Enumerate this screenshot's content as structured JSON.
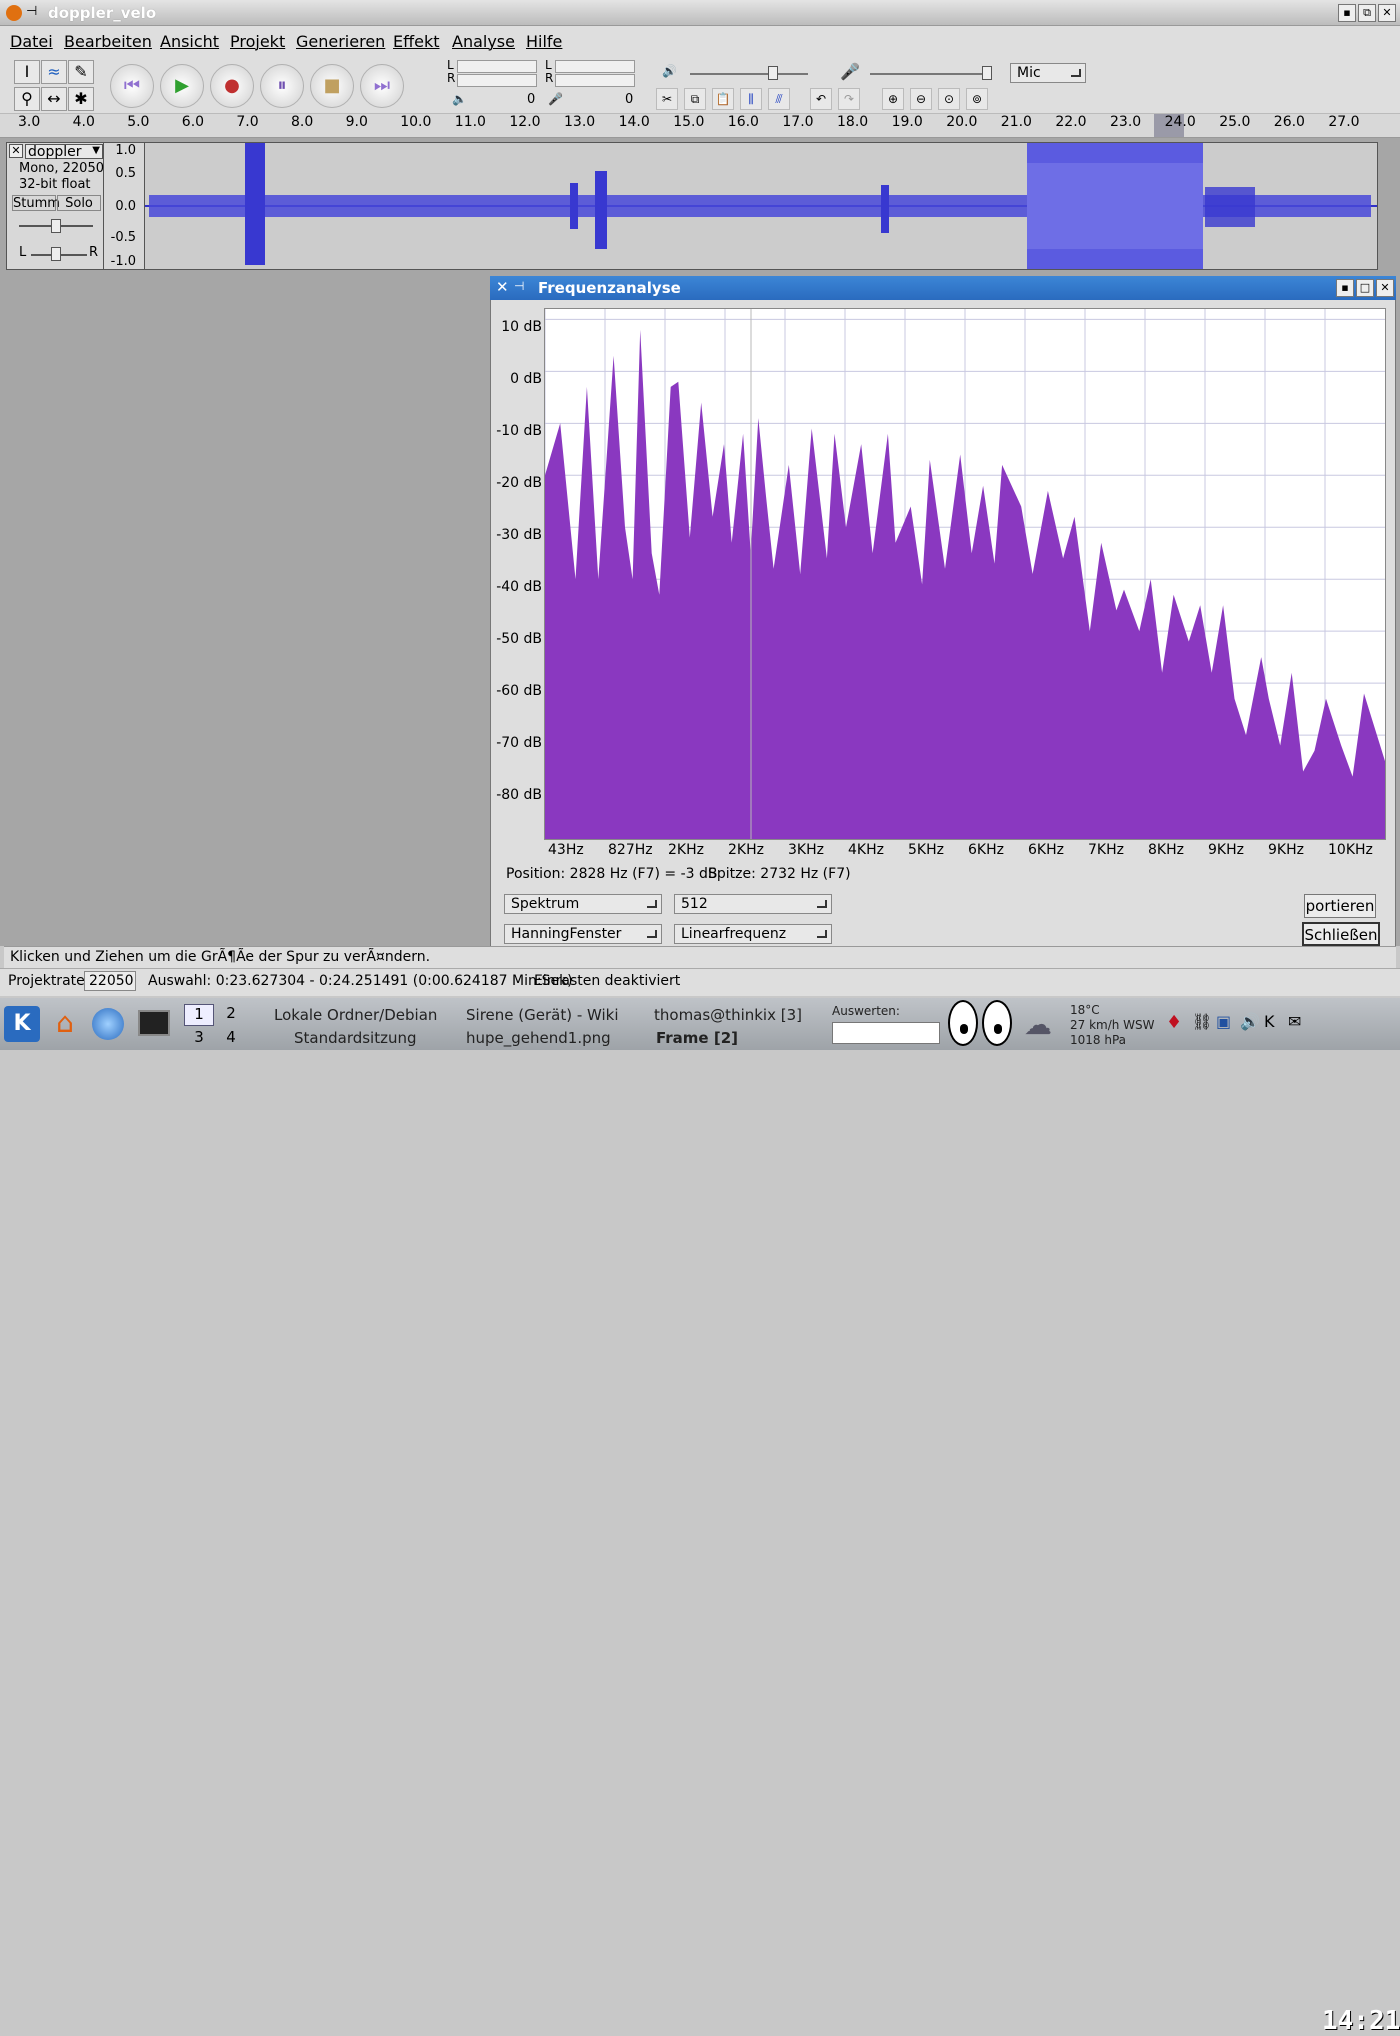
{
  "window": {
    "title": "doppler_velo"
  },
  "menu": [
    "Datei",
    "Bearbeiten",
    "Ansicht",
    "Projekt",
    "Generieren",
    "Effekt",
    "Analyse",
    "Hilfe"
  ],
  "toolbar": {
    "meter_l": "L",
    "meter_r": "R",
    "out_val": "0",
    "in_val": "0",
    "input_source": "Mic"
  },
  "ruler": [
    "3.0",
    "4.0",
    "5.0",
    "6.0",
    "7.0",
    "8.0",
    "9.0",
    "10.0",
    "11.0",
    "12.0",
    "13.0",
    "14.0",
    "15.0",
    "16.0",
    "17.0",
    "18.0",
    "19.0",
    "20.0",
    "21.0",
    "22.0",
    "23.0",
    "24.0",
    "25.0",
    "26.0",
    "27.0"
  ],
  "track": {
    "name": "doppler",
    "info1": "Mono, 22050 Hz",
    "info2": "32-bit float",
    "mute": "Stumm",
    "solo": "Solo",
    "left": "L",
    "right": "R",
    "scale": [
      "1.0",
      "0.5",
      "0.0",
      "-0.5",
      "-1.0"
    ]
  },
  "dialog": {
    "title": "Frequenzanalyse",
    "position": "Position: 2828 Hz (F7) = -3 dB",
    "peak": "Spitze: 2732 Hz (F7)",
    "algorithm": "Spektrum",
    "size": "512",
    "window_func": "HanningFenster",
    "axis_mode": "Linearfrequenz",
    "export": "portieren",
    "close": "Schließen"
  },
  "chart_data": {
    "type": "area",
    "title": "",
    "ylabel": "",
    "xlabel": "",
    "y_ticks": [
      "10 dB",
      "0 dB",
      "-10 dB",
      "-20 dB",
      "-30 dB",
      "-40 dB",
      "-50 dB",
      "-60 dB",
      "-70 dB",
      "-80 dB"
    ],
    "x_ticks": [
      "43Hz",
      "827Hz",
      "2KHz",
      "2KHz",
      "3KHz",
      "4KHz",
      "5KHz",
      "6KHz",
      "6KHz",
      "7KHz",
      "8KHz",
      "9KHz",
      "9KHz",
      "10KHz"
    ],
    "ylim": [
      -90,
      12
    ],
    "xlim": [
      0,
      11025
    ],
    "series": [
      {
        "color": "#8a38c0",
        "x": [
          0,
          200,
          400,
          550,
          700,
          900,
          1050,
          1150,
          1250,
          1400,
          1500,
          1650,
          1750,
          1900,
          2050,
          2200,
          2350,
          2450,
          2600,
          2700,
          2800,
          2900,
          3000,
          3200,
          3350,
          3500,
          3700,
          3800,
          3950,
          4150,
          4300,
          4500,
          4600,
          4800,
          4950,
          5050,
          5250,
          5450,
          5600,
          5750,
          5900,
          6000,
          6250,
          6400,
          6600,
          6800,
          6950,
          7150,
          7300,
          7500,
          7600,
          7800,
          7950,
          8100,
          8250,
          8450,
          8600,
          8750,
          8900,
          9050,
          9200,
          9400,
          9500,
          9650,
          9800,
          9950,
          10100,
          10250,
          10450,
          10600,
          10750,
          11025
        ],
        "values": [
          -20,
          -10,
          -40,
          -3,
          -40,
          3,
          -30,
          -40,
          8,
          -35,
          -43,
          -3,
          -2,
          -32,
          -6,
          -28,
          -14,
          -33,
          -12,
          -35,
          -9,
          -24,
          -38,
          -18,
          -39,
          -11,
          -36,
          -12,
          -30,
          -14,
          -35,
          -12,
          -33,
          -26,
          -41,
          -17,
          -38,
          -16,
          -35,
          -22,
          -37,
          -18,
          -26,
          -39,
          -23,
          -36,
          -28,
          -50,
          -33,
          -46,
          -42,
          -50,
          -40,
          -58,
          -43,
          -52,
          -45,
          -58,
          -45,
          -63,
          -70,
          -55,
          -63,
          -72,
          -58,
          -77,
          -73,
          -63,
          -72,
          -78,
          -62,
          -75
        ]
      }
    ]
  },
  "statusbar": {
    "hint": "Klicken und Ziehen um die GrÃ¶Ãe der Spur zu verÃ¤ndern.",
    "rate_label": "Projektrate:",
    "rate": "22050",
    "selection": "Auswahl: 0:23.627304 - 0:24.251491 (0:00.624187 Min:Sek)",
    "snap": "Einrasten deaktiviert"
  },
  "taskbar": {
    "desktops": [
      "1",
      "2",
      "3",
      "4"
    ],
    "tasks": [
      "Lokale Ordner/Debian",
      "Sirene (Gerät) - Wiki",
      "thomas@thinkix [3]",
      "Standardsitzung",
      "hupe_gehend1.png",
      "Frame [2]"
    ],
    "search_label": "Auswerten:",
    "weather": [
      "18°C",
      "27 km/h WSW",
      "1018 hPa"
    ],
    "clock": "14:21"
  }
}
